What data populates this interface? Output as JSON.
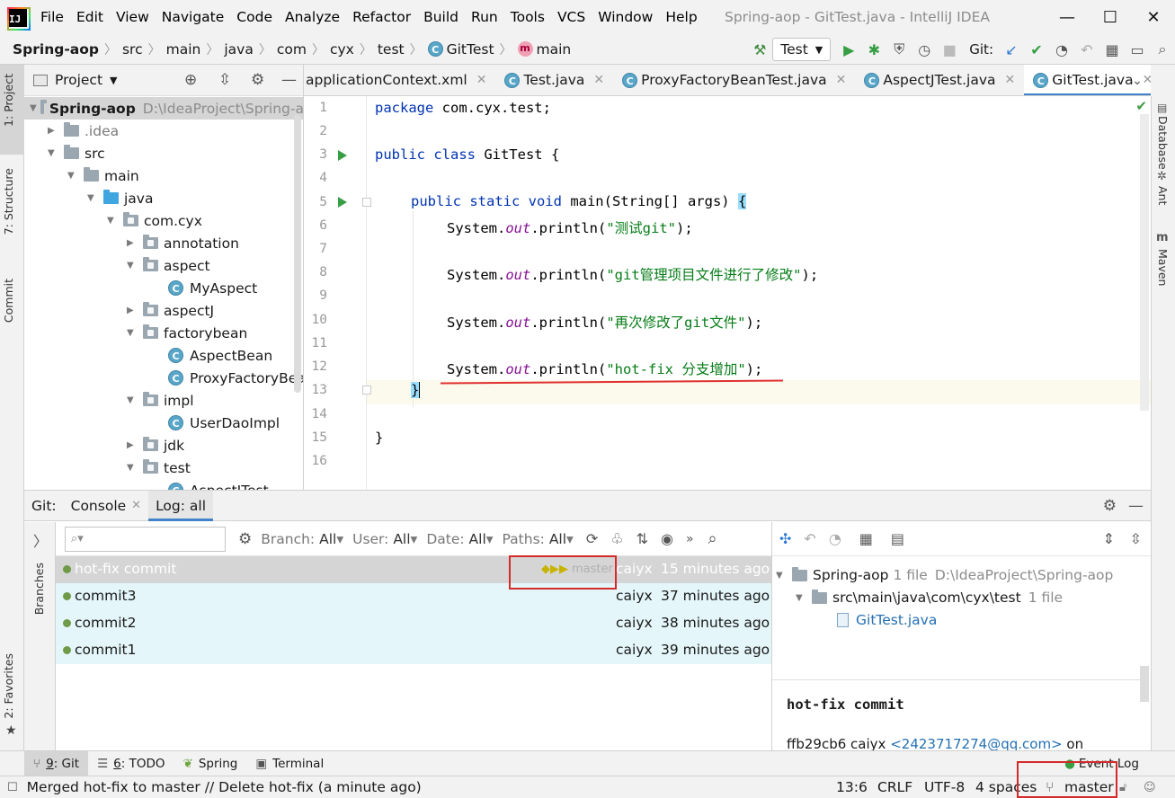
{
  "menubar": {
    "items": [
      "File",
      "Edit",
      "View",
      "Navigate",
      "Code",
      "Analyze",
      "Refactor",
      "Build",
      "Run",
      "Tools",
      "VCS",
      "Window",
      "Help"
    ],
    "title": "Spring-aop - GitTest.java - IntelliJ IDEA"
  },
  "breadcrumbs": [
    "Spring-aop",
    "src",
    "main",
    "java",
    "com",
    "cyx",
    "test",
    "GitTest",
    "main"
  ],
  "toolbar": {
    "run_config": "Test",
    "git_label": "Git:"
  },
  "left_strip": {
    "project": "1: Project",
    "structure": "7: Structure",
    "commit": "Commit",
    "favorites": "2: Favorites"
  },
  "right_strip": {
    "database": "Database",
    "ant": "Ant",
    "maven": "Maven"
  },
  "project": {
    "title": "Project",
    "root": {
      "name": "Spring-aop",
      "path": "D:\\IdeaProject\\Spring-a"
    },
    "nodes": [
      ".idea",
      "src",
      "main",
      "java",
      "com.cyx",
      "annotation",
      "aspect",
      "MyAspect",
      "aspectJ",
      "factorybean",
      "AspectBean",
      "ProxyFactoryBear",
      "impl",
      "UserDaoImpl",
      "jdk",
      "test",
      "AspectJTest"
    ]
  },
  "editor": {
    "tabs": [
      "applicationContext.xml",
      "Test.java",
      "ProxyFactoryBeanTest.java",
      "AspectJTest.java",
      "GitTest.java"
    ],
    "line_numbers": [
      "1",
      "2",
      "3",
      "4",
      "5",
      "6",
      "7",
      "8",
      "9",
      "10",
      "11",
      "12",
      "13",
      "14",
      "15",
      "16"
    ],
    "code": {
      "l1_kw": "package",
      "l1_rest": " com.cyx.test;",
      "l3_kw": "public class",
      "l3_rest": " GitTest {",
      "l5_kw": "public static void",
      "l5_rest": " main(String[] args) ",
      "println_prefix": "System.",
      "out": "out",
      "println": ".println(",
      "s6": "\"测试git\"",
      "s8": "\"git管理项目文件进行了修改\"",
      "s10": "\"再次修改了git文件\"",
      "s12": "\"hot-fix 分支增加\"",
      "end": ");",
      "close_brace": "}",
      "open_brace": "{"
    }
  },
  "git_panel": {
    "title": "Git:",
    "tabs": [
      "Console",
      "Log: all"
    ],
    "branches_label": "Branches",
    "search_placeholder": "",
    "filters": [
      {
        "label": "Branch:",
        "value": "All"
      },
      {
        "label": "User:",
        "value": "All"
      },
      {
        "label": "Date:",
        "value": "All"
      },
      {
        "label": "Paths:",
        "value": "All"
      }
    ],
    "commits": [
      {
        "message": "hot-fix commit",
        "author": "caiyx",
        "time": "15 minutes ago",
        "branch": "master"
      },
      {
        "message": "commit3",
        "author": "caiyx",
        "time": "37 minutes ago"
      },
      {
        "message": "commit2",
        "author": "caiyx",
        "time": "38 minutes ago"
      },
      {
        "message": "commit1",
        "author": "caiyx",
        "time": "39 minutes ago"
      }
    ],
    "details": {
      "root": "Spring-aop",
      "root_count": "1 file",
      "root_path": "D:\\IdeaProject\\Spring-aop",
      "dir": "src\\main\\java\\com\\cyx\\test",
      "dir_count": "1 file",
      "file": "GitTest.java",
      "commit_title": "hot-fix commit",
      "hash": "ffb29cb6",
      "author": "caiyx",
      "email": "<2423717274@qq.com>",
      "on": "on"
    }
  },
  "bottom_tabs": [
    {
      "num": "9",
      "label": ": Git"
    },
    {
      "num": "6",
      "label": ": TODO"
    },
    {
      "num": "",
      "label": "Spring"
    },
    {
      "num": "",
      "label": "Terminal"
    }
  ],
  "event_log": "Event Log",
  "statusbar": {
    "message": "Merged hot-fix to master // Delete hot-fix (a minute ago)",
    "position": "13:6",
    "line_sep": "CRLF",
    "encoding": "UTF-8",
    "indent": "4 spaces",
    "branch": "master"
  }
}
